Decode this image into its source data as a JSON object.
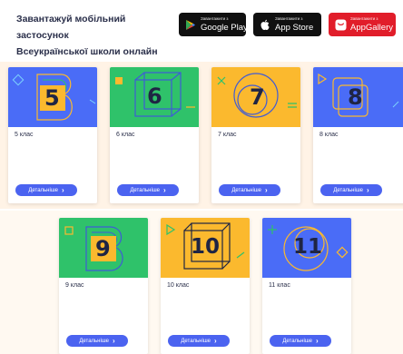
{
  "promo": {
    "line1": "Завантажуй мобільний застосунок",
    "line2": "Всеукраїнської школи онлайн"
  },
  "stores": [
    {
      "small": "Завантажити з",
      "big": "Google Play",
      "icon": "google-play-icon",
      "color": "#101010"
    },
    {
      "small": "Завантажити з",
      "big": "App Store",
      "icon": "apple-icon",
      "color": "#101010"
    },
    {
      "small": "Завантажити з",
      "big": "AppGallery",
      "icon": "huawei-appgallery-icon",
      "color": "#e11d2a"
    }
  ],
  "cards": [
    {
      "number": "5",
      "title": "5 клас",
      "button": "Детальніше",
      "color": "#4a6cf7"
    },
    {
      "number": "6",
      "title": "6 клас",
      "button": "Детальніше",
      "color": "#2fc26a"
    },
    {
      "number": "7",
      "title": "7 клас",
      "button": "Детальніше",
      "color": "#fbb92e"
    },
    {
      "number": "8",
      "title": "8 клас",
      "button": "Детальніше",
      "color": "#4a6cf7"
    },
    {
      "number": "9",
      "title": "9 клас",
      "button": "Детальніше",
      "color": "#2fc26a"
    },
    {
      "number": "10",
      "title": "10 клас",
      "button": "Детальніше",
      "color": "#fbb92e"
    },
    {
      "number": "11",
      "title": "11 клас",
      "button": "Детальніше",
      "color": "#4a6cf7"
    }
  ]
}
